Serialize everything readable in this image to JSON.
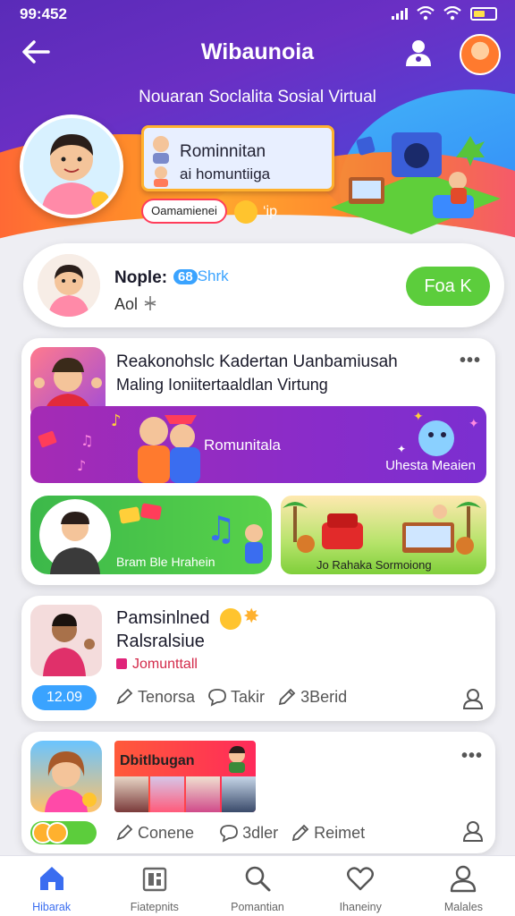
{
  "status_bar": {
    "time": "99:452"
  },
  "header": {
    "title": "Wibaunoia",
    "subtitle": "Nouaran Soclalita Sosial Virtual",
    "banner_line1": "Rominnitan",
    "banner_line2": "ai homuntiiga",
    "pill_label": "Oamamienei",
    "extra": "‘ip"
  },
  "profile": {
    "name": "Nople:",
    "badge_number": "68",
    "badge_text": "Shrk",
    "sub": "Aol",
    "follow_label": "Foa K"
  },
  "feed1": {
    "title": "Reakonohslc Kadertan Uanbamiusah",
    "subtitle": "Maling Ioniitertaaldlan Virtung",
    "banner_label": "Romunitala",
    "banner_sub": "Uhesta Meaien",
    "card_green_label": "Bram Ble Hrahein",
    "card_scene_label": "Jo Rahaka Sormoiong"
  },
  "feed2": {
    "name": "Pamsinlned",
    "subname": "Ralsralsiue",
    "tag": "Jomunttall",
    "count": "12.09",
    "actions": [
      {
        "label": "Tenorsa",
        "icon": "pen-icon"
      },
      {
        "label": "Takir",
        "icon": "comment-icon"
      },
      {
        "label": "3Berid",
        "icon": "pencil-icon"
      }
    ]
  },
  "feed3": {
    "banner_label": "Dbitlbugan",
    "actions": [
      {
        "label": "Conene",
        "icon": "pen-icon"
      },
      {
        "label": "3dler",
        "icon": "comment-icon"
      },
      {
        "label": "Reimet",
        "icon": "pencil-icon"
      }
    ]
  },
  "nav": [
    {
      "label": "Hibarak",
      "icon": "home-icon",
      "active": true
    },
    {
      "label": "Fiatepnits",
      "icon": "feed-icon",
      "active": false
    },
    {
      "label": "Pomantian",
      "icon": "search-icon",
      "active": false
    },
    {
      "label": "Ihaneiny",
      "icon": "heart-icon",
      "active": false
    },
    {
      "label": "Malales",
      "icon": "profile-icon",
      "active": false
    }
  ],
  "colors": {
    "header_purple": "#6a2fc4",
    "accent_blue": "#3aa3ff",
    "follow_green": "#5ccd3c",
    "nav_active": "#3a6df0"
  }
}
